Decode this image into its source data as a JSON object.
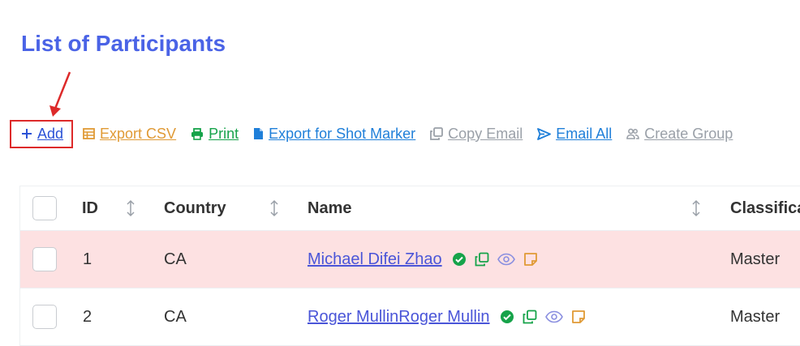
{
  "page": {
    "title": "List of Participants"
  },
  "toolbar": {
    "add_label": "Add",
    "export_csv_label": "Export CSV",
    "print_label": "Print",
    "export_shot_label": "Export for Shot Marker",
    "copy_email_label": "Copy Email",
    "email_all_label": "Email All",
    "create_group_label": "Create Group"
  },
  "table": {
    "columns": [
      "ID",
      "Country",
      "Name",
      "Classifica"
    ],
    "rows": [
      {
        "id": "1",
        "country": "CA",
        "name": "Michael Difei Zhao",
        "classification": "Master"
      },
      {
        "id": "2",
        "country": "CA",
        "name": "Roger MullinRoger Mullin",
        "classification": "Master"
      }
    ]
  },
  "colors": {
    "title": "#4a63e6",
    "highlight_row": "#fde1e2",
    "annotation_red": "#dd2a2a"
  }
}
